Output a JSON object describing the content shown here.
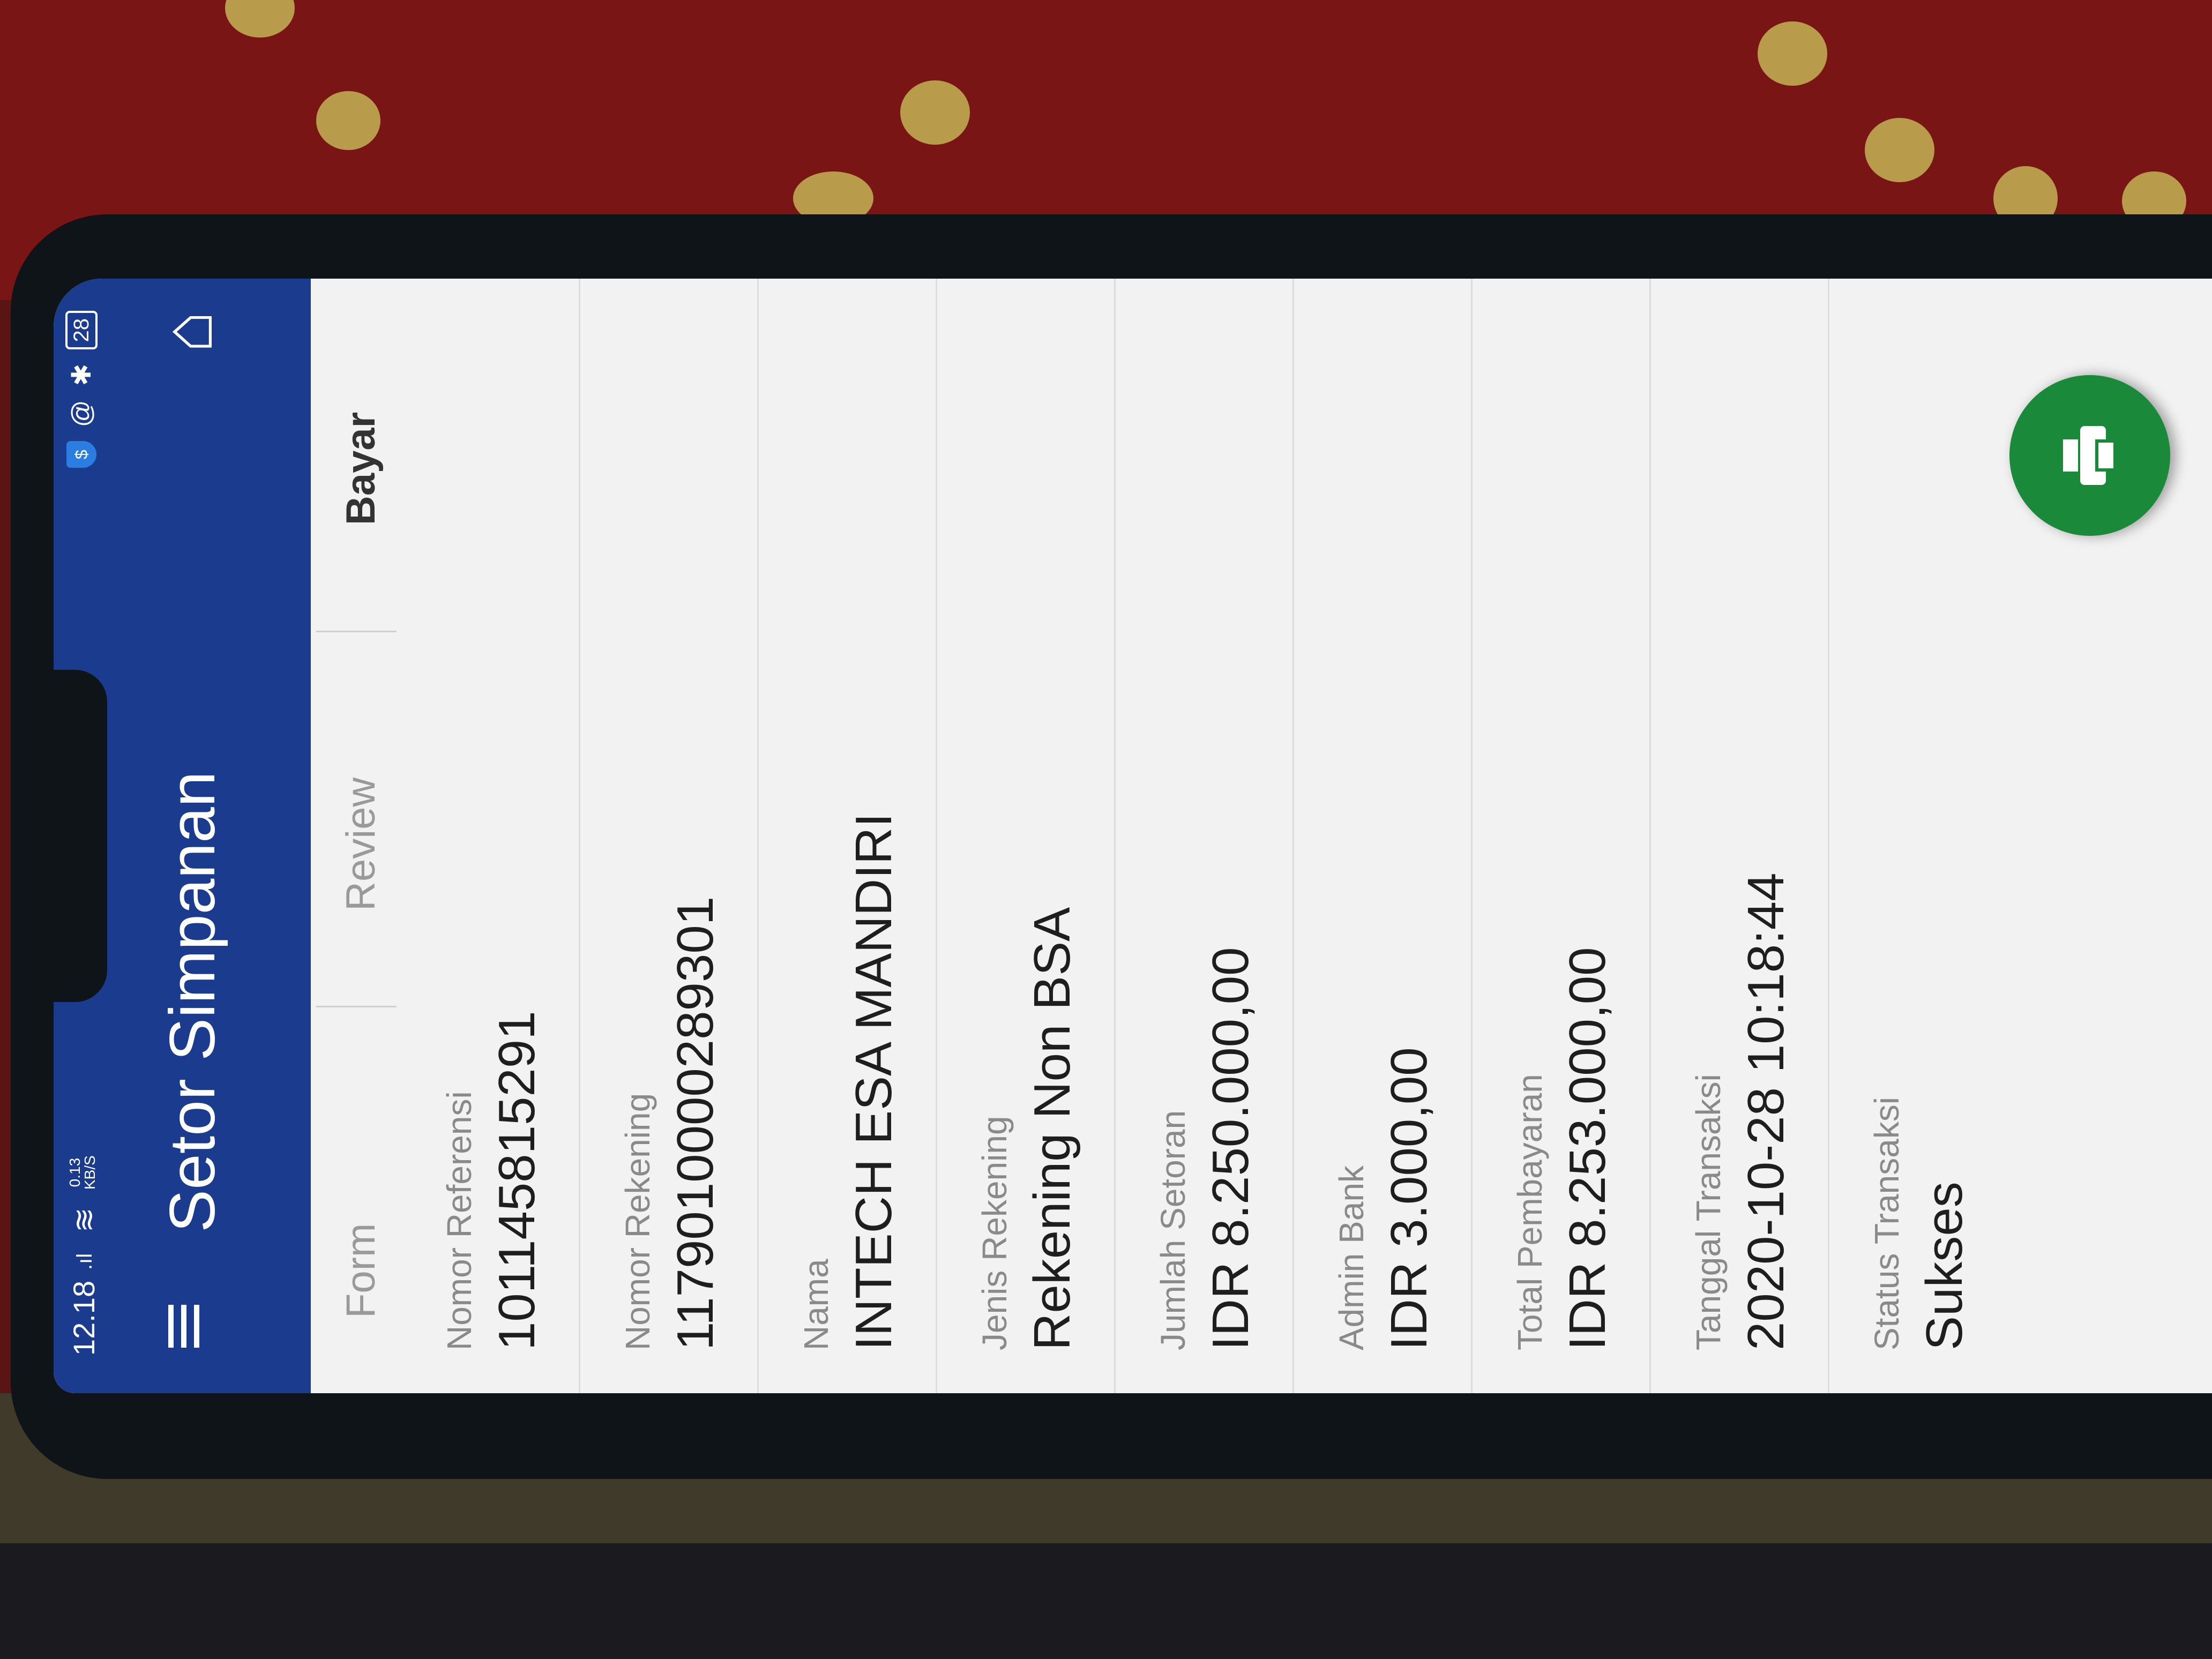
{
  "status_bar": {
    "time": "12.18",
    "signal": ".ıl",
    "network_speed": "0.13\nKB/S",
    "wifi_icon": "wifi-icon",
    "shield_label": "$",
    "alarm_icon": "@",
    "bluetooth_icon": "✱",
    "battery": "28"
  },
  "app_bar": {
    "title": "Setor Simpanan",
    "menu_icon": "menu-icon",
    "home_icon": "home-icon",
    "color": "#1b3b8e"
  },
  "stepper": {
    "steps": [
      {
        "label": "Form",
        "active": false
      },
      {
        "label": "Review",
        "active": false
      },
      {
        "label": "Bayar",
        "active": true
      }
    ]
  },
  "fields": [
    {
      "label": "Nomor Referensi",
      "value": "101145815291"
    },
    {
      "label": "Nomor Rekening",
      "value": "1179010000289301"
    },
    {
      "label": "Nama",
      "value": "INTECH ESA MANDIRI"
    },
    {
      "label": "Jenis Rekening",
      "value": "Rekening Non BSA"
    },
    {
      "label": "Jumlah Setoran",
      "value": "IDR 8.250.000,00"
    },
    {
      "label": "Admin Bank",
      "value": "IDR 3.000,00"
    },
    {
      "label": "Total Pembayaran",
      "value": "IDR 8.253.000,00"
    },
    {
      "label": "Tanggal Transaksi",
      "value": "2020-10-28 10:18:44"
    },
    {
      "label": "Status Transaksi",
      "value": "Sukses"
    }
  ],
  "fab": {
    "icon": "printer-icon",
    "color": "#1a8a3a"
  }
}
